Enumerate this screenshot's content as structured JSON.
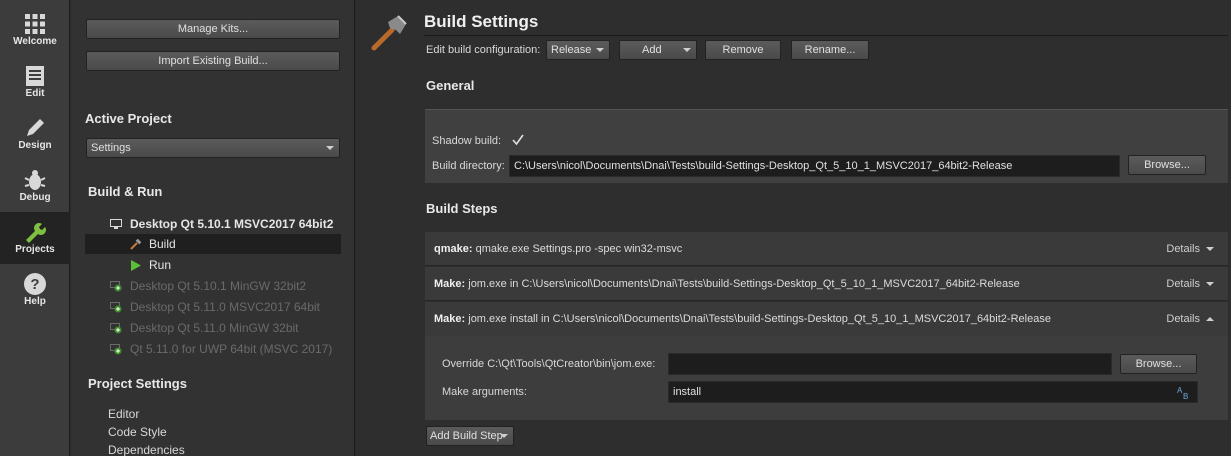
{
  "modes": [
    {
      "label": "Welcome",
      "icon": "grid-icon"
    },
    {
      "label": "Edit",
      "icon": "document-icon"
    },
    {
      "label": "Design",
      "icon": "pencil-icon"
    },
    {
      "label": "Debug",
      "icon": "bug-icon"
    },
    {
      "label": "Projects",
      "icon": "wrench-icon"
    },
    {
      "label": "Help",
      "icon": "question-icon"
    }
  ],
  "sidebar": {
    "manage_kits": "Manage Kits...",
    "import_build": "Import Existing Build...",
    "active_project_heading": "Active Project",
    "active_project_value": "Settings",
    "build_run_heading": "Build & Run",
    "kits": [
      "Desktop Qt 5.10.1 MSVC2017 64bit2",
      "Build",
      "Run",
      "Desktop Qt 5.10.1 MinGW 32bit2",
      "Desktop Qt 5.11.0 MSVC2017 64bit",
      "Desktop Qt 5.11.0 MinGW 32bit",
      "Qt 5.11.0 for UWP 64bit (MSVC 2017)"
    ],
    "project_settings_heading": "Project Settings",
    "project_settings": [
      "Editor",
      "Code Style",
      "Dependencies"
    ]
  },
  "main": {
    "title": "Build Settings",
    "edit_config_label": "Edit build configuration:",
    "config_value": "Release",
    "add_label": "Add",
    "remove_label": "Remove",
    "rename_label": "Rename...",
    "general_heading": "General",
    "shadow_build_label": "Shadow build:",
    "build_dir_label": "Build directory:",
    "build_dir_value": "C:\\Users\\nicol\\Documents\\Dnai\\Tests\\build-Settings-Desktop_Qt_5_10_1_MSVC2017_64bit2-Release",
    "browse_label": "Browse...",
    "build_steps_heading": "Build Steps",
    "steps": [
      {
        "name": "qmake:",
        "text": "qmake.exe Settings.pro -spec win32-msvc",
        "details": "Details"
      },
      {
        "name": "Make:",
        "text": "jom.exe in C:\\Users\\nicol\\Documents\\Dnai\\Tests\\build-Settings-Desktop_Qt_5_10_1_MSVC2017_64bit2-Release",
        "details": "Details"
      },
      {
        "name": "Make:",
        "text": "jom.exe install in C:\\Users\\nicol\\Documents\\Dnai\\Tests\\build-Settings-Desktop_Qt_5_10_1_MSVC2017_64bit2-Release",
        "details": "Details"
      }
    ],
    "override_label": "Override C:\\Qt\\Tools\\QtCreator\\bin\\jom.exe:",
    "override_value": "",
    "browse2_label": "Browse...",
    "make_args_label": "Make arguments:",
    "make_args_value": "install",
    "add_build_step": "Add Build Step"
  }
}
